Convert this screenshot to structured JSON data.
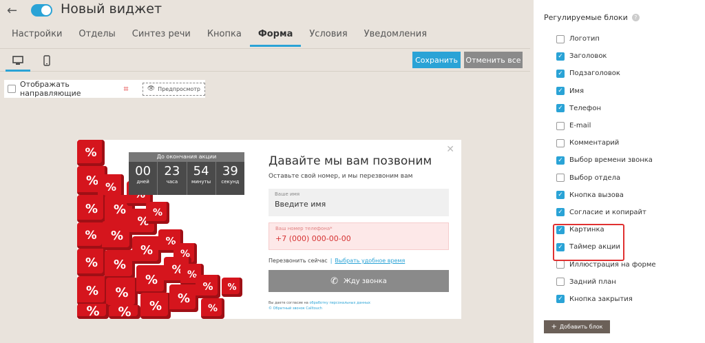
{
  "header": {
    "title": "Новый виджет",
    "enabled": true
  },
  "tabs": [
    {
      "label": "Настройки",
      "active": false
    },
    {
      "label": "Отделы",
      "active": false
    },
    {
      "label": "Синтез речи",
      "active": false
    },
    {
      "label": "Кнопка",
      "active": false
    },
    {
      "label": "Форма",
      "active": true
    },
    {
      "label": "Условия",
      "active": false
    },
    {
      "label": "Уведомления",
      "active": false
    }
  ],
  "toolbar": {
    "save_label": "Сохранить",
    "cancel_label": "Отменить все"
  },
  "guides": {
    "label": "Отображать направляющие",
    "preview_label": "Предпросмотр"
  },
  "widget": {
    "timer": {
      "title": "До окончания акции",
      "cells": [
        {
          "value": "00",
          "unit": "дней"
        },
        {
          "value": "23",
          "unit": "часа"
        },
        {
          "value": "54",
          "unit": "минуты"
        },
        {
          "value": "39",
          "unit": "секунд"
        }
      ]
    },
    "dice_symbol": "%",
    "title": "Давайте мы вам позвоним",
    "subtitle": "Оставьте свой номер, и мы перезвоним вам",
    "name_field": {
      "label": "Ваше имя",
      "placeholder": "Введите имя"
    },
    "phone_field": {
      "label": "Ваш номер телефона*",
      "placeholder": "+7 (000) 000-00-00"
    },
    "call_now": "Перезвонить сейчас",
    "separator": "|",
    "choose_time": "Выбрать удобное время",
    "call_button": "Жду звонка",
    "consent_text": "Вы даете согласие на",
    "consent_link": "обработку персональных данных",
    "copyright": "© Обратный звонок Calltouch"
  },
  "panel": {
    "title": "Регулируемые блоки",
    "blocks": [
      {
        "label": "Логотип",
        "checked": false
      },
      {
        "label": "Заголовок",
        "checked": true
      },
      {
        "label": "Подзаголовок",
        "checked": true
      },
      {
        "label": "Имя",
        "checked": true
      },
      {
        "label": "Телефон",
        "checked": true
      },
      {
        "label": "E-mail",
        "checked": false
      },
      {
        "label": "Комментарий",
        "checked": false
      },
      {
        "label": "Выбор времени звонка",
        "checked": true
      },
      {
        "label": "Выбор отдела",
        "checked": false
      },
      {
        "label": "Кнопка вызова",
        "checked": true
      },
      {
        "label": "Согласие и копирайт",
        "checked": true
      },
      {
        "label": "Картинка",
        "checked": true
      },
      {
        "label": "Таймер акции",
        "checked": true
      },
      {
        "label": "Иллюстрация на форме",
        "checked": false
      },
      {
        "label": "Задний план",
        "checked": false
      },
      {
        "label": "Кнопка закрытия",
        "checked": true
      }
    ],
    "add_block_label": "Добавить блок"
  },
  "colors": {
    "accent": "#2aa3d6",
    "highlight": "#e03030",
    "dice": "#d5151d"
  }
}
